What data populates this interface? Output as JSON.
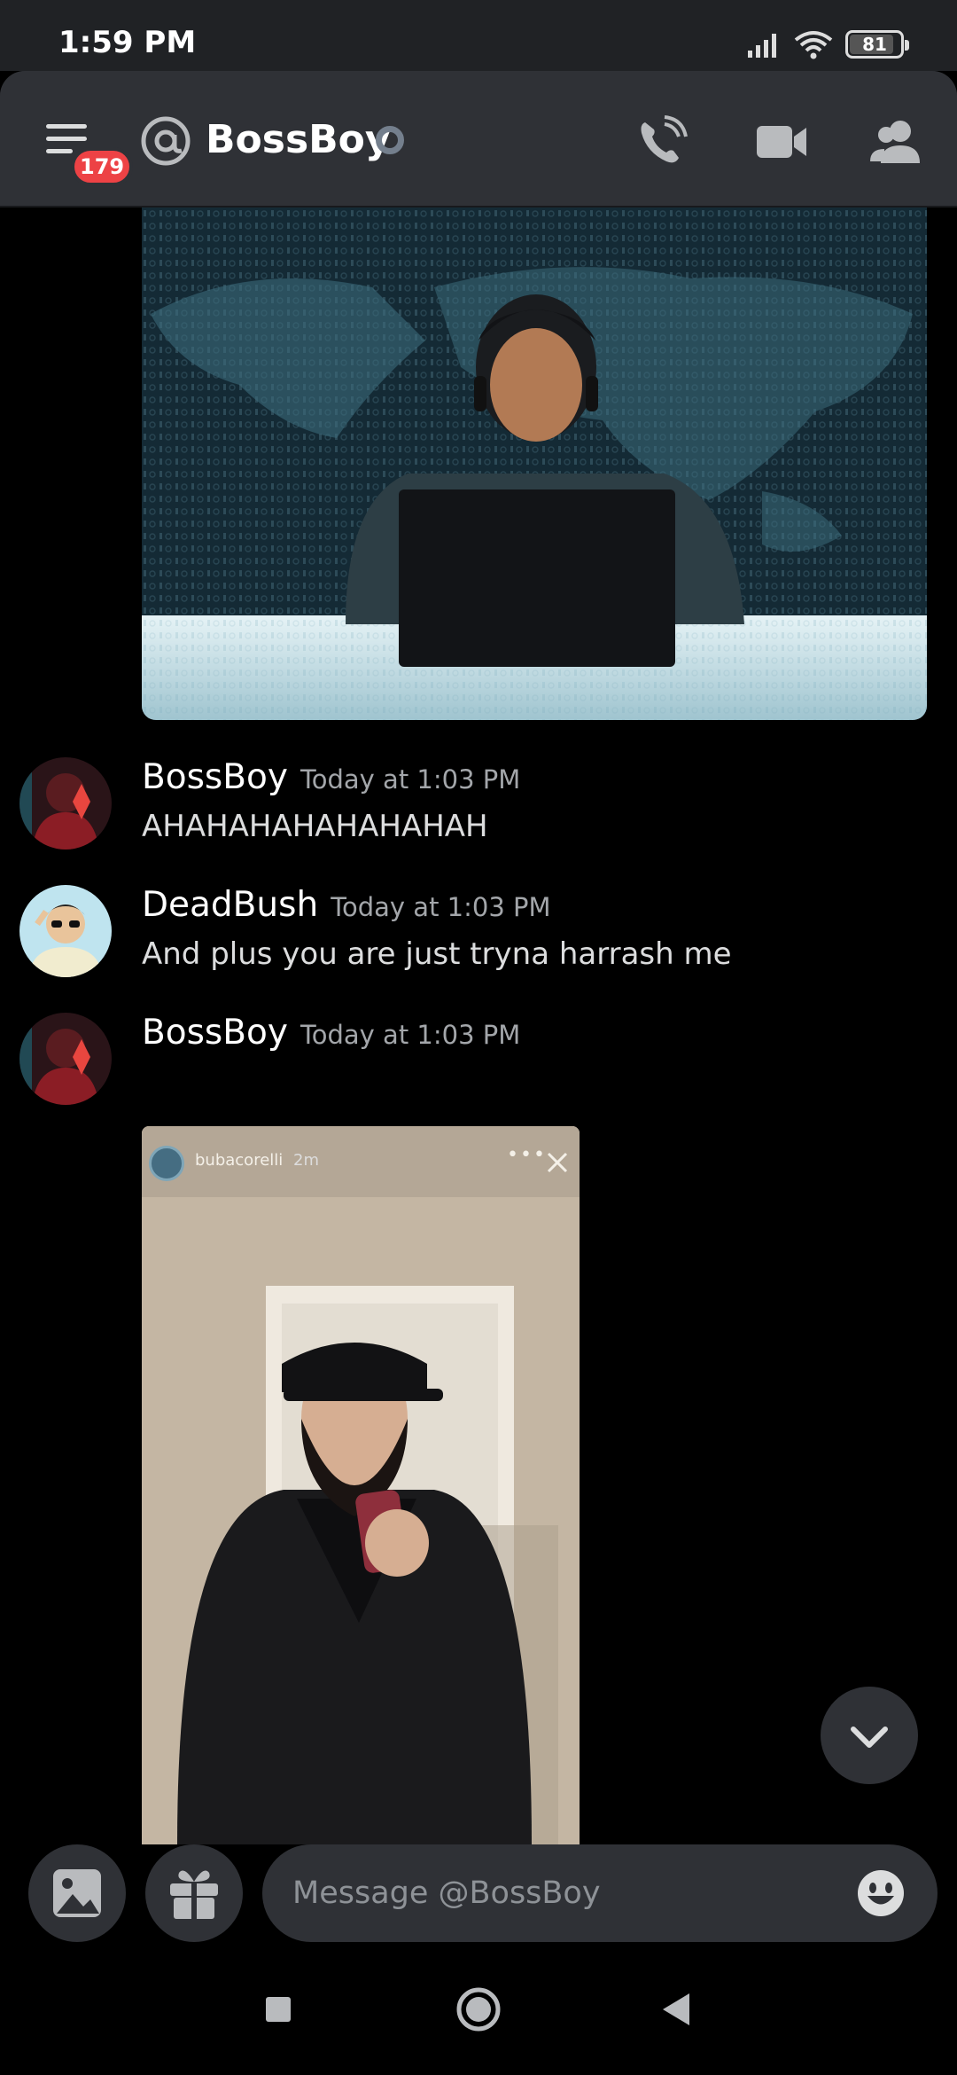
{
  "status_bar": {
    "time": "1:59 PM",
    "battery": "81",
    "battery_level": 0.81
  },
  "header": {
    "badge_count": "179",
    "title": "BossBoy",
    "icons": [
      "menu-icon",
      "at-icon",
      "status-idle-icon",
      "phone-call-icon",
      "video-camera-icon",
      "members-icon"
    ]
  },
  "messages": [
    {
      "author": "BossBoy",
      "timestamp": "Today at 1:03 PM",
      "text": "AHAHAHAHAHAHAHAH"
    },
    {
      "author": "DeadBush",
      "timestamp": "Today at 1:03 PM",
      "text": "And plus you are just tryna harrash me"
    },
    {
      "author": "BossBoy",
      "timestamp": "Today at 1:03 PM",
      "text": ""
    }
  ],
  "attachments": {
    "story_username": "bubacorelli",
    "story_age": "2m"
  },
  "composer": {
    "placeholder": "Message @BossBoy"
  },
  "colors": {
    "background": "#000000",
    "header": "#2f3136",
    "badge": "#ed4245",
    "text_muted": "#a3a6aa",
    "input_bg": "#2f3136"
  }
}
